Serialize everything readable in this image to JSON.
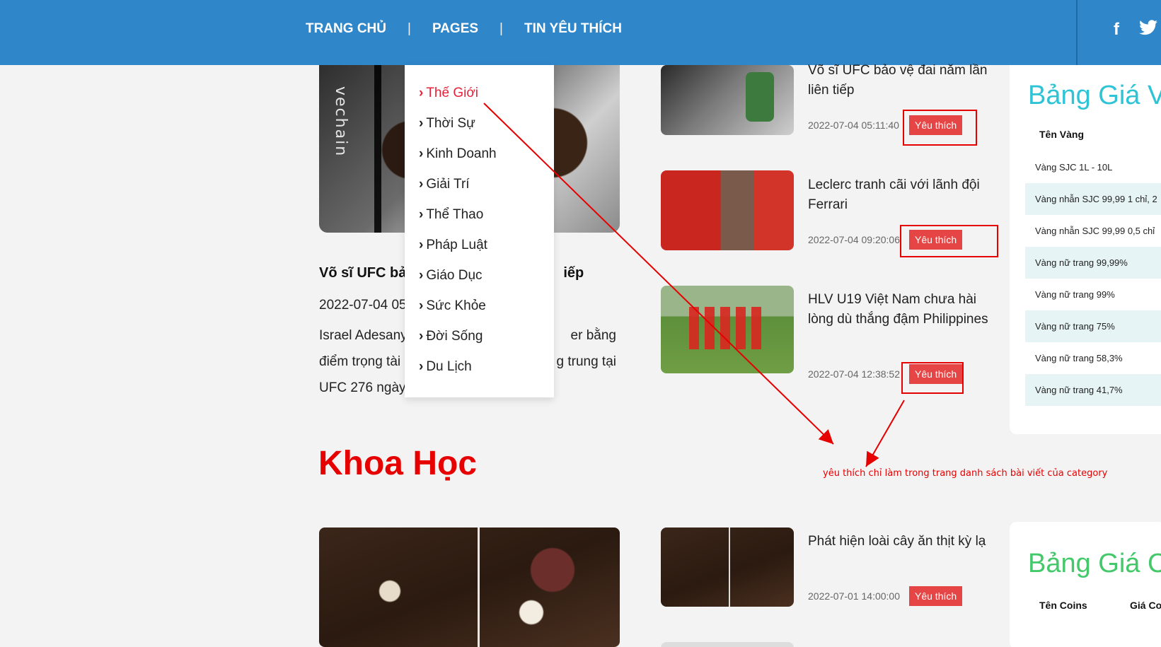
{
  "nav": {
    "items": [
      "TRANG CHỦ",
      "PAGES",
      "TIN YÊU THÍCH"
    ],
    "separator": "|",
    "social": {
      "facebook": "f",
      "twitter": "t"
    }
  },
  "dropdown": {
    "items": [
      "Thế Giới",
      "Thời Sự",
      "Kinh Doanh",
      "Giải Trí",
      "Thể Thao",
      "Pháp Luật",
      "Giáo Dục",
      "Sức Khỏe",
      "Đời Sống",
      "Du Lịch"
    ],
    "active_index": 0
  },
  "featured": {
    "title_left": "Võ sĩ UFC bả",
    "title_right": "iếp",
    "date": "2022-07-04 05",
    "excerpt_left": [
      "Israel Adesany",
      "điểm trọng tài",
      "UFC 276 ngày"
    ],
    "excerpt_right": [
      "er bằng",
      "g trung tại",
      ""
    ]
  },
  "articles": [
    {
      "title": "Võ sĩ UFC bảo vệ đai năm lần liên tiếp",
      "date": "2022-07-04 05:11:40",
      "button": "Yêu thích"
    },
    {
      "title": "Leclerc tranh cãi với lãnh đội Ferrari",
      "date": "2022-07-04 09:20:06",
      "button": "Yêu thích"
    },
    {
      "title": "HLV U19 Việt Nam chưa hài lòng dù thắng đậm Philippines",
      "date": "2022-07-04 12:38:52",
      "button": "Yêu thích"
    },
    {
      "title": "Phát hiện loài cây ăn thịt kỳ lạ",
      "date": "2022-07-01 14:00:00",
      "button": "Yêu thích"
    }
  ],
  "section": {
    "title": "Khoa Học"
  },
  "annotation": "yêu thích chỉ làm trong trang danh sách bài viết của category",
  "gold_card": {
    "title": "Bảng Giá V",
    "column": "Tên Vàng",
    "rows": [
      "Vàng SJC 1L - 10L",
      "Vàng nhẫn SJC 99,99 1 chỉ, 2",
      "Vàng nhẫn SJC 99,99 0,5 chỉ",
      "Vàng nữ trang 99,99%",
      "Vàng nữ trang 99%",
      "Vàng nữ trang 75%",
      "Vàng nữ trang 58,3%",
      "Vàng nữ trang 41,7%"
    ]
  },
  "coin_card": {
    "title": "Bảng Giá C",
    "columns": [
      "Tên Coins",
      "Giá Co"
    ]
  },
  "colors": {
    "header": "#2f86c9",
    "accent_red": "#e60000",
    "fav_button": "#e64545",
    "gold_title": "#2ec4d6",
    "coin_title": "#43c86a"
  }
}
